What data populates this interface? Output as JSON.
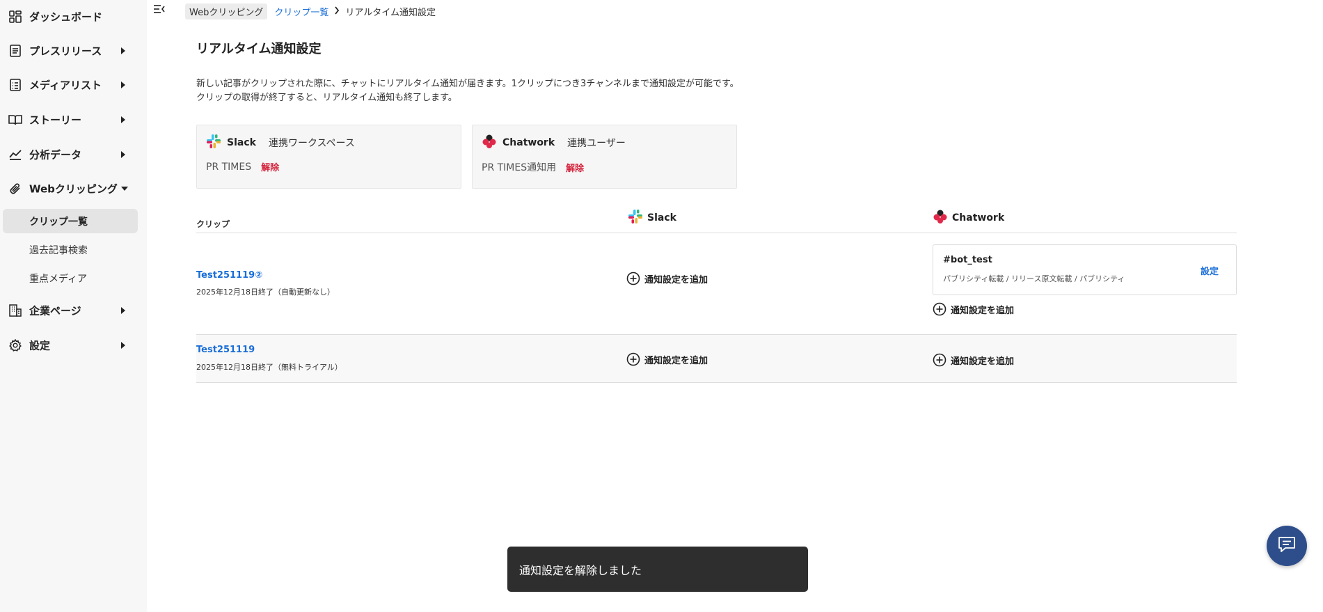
{
  "sidebar": {
    "items": [
      {
        "label": "ダッシュボード",
        "icon": "dashboard-icon"
      },
      {
        "label": "プレスリリース",
        "icon": "document-icon"
      },
      {
        "label": "メディアリスト",
        "icon": "list-icon"
      },
      {
        "label": "ストーリー",
        "icon": "book-icon"
      },
      {
        "label": "分析データ",
        "icon": "chart-line-icon"
      },
      {
        "label": "Webクリッピング",
        "icon": "paperclip-icon"
      },
      {
        "label": "企業ページ",
        "icon": "building-icon"
      },
      {
        "label": "設定",
        "icon": "gear-icon"
      }
    ],
    "subitems": [
      {
        "label": "クリップ一覧",
        "active": true
      },
      {
        "label": "過去記事検索",
        "active": false
      },
      {
        "label": "重点メディア",
        "active": false
      }
    ]
  },
  "breadcrumb": {
    "root": "Webクリッピング",
    "parent": "クリップ一覧",
    "current": "リアルタイム通知設定"
  },
  "page": {
    "title": "リアルタイム通知設定",
    "desc_line1": "新しい記事がクリップされた際に、チャットにリアルタイム通知が届きます。1クリップにつき3チャンネルまで通知設定が可能です。",
    "desc_line2": "クリップの取得が終了すると、リアルタイム通知も終了します。"
  },
  "integrations": {
    "slack": {
      "service": "Slack",
      "kind": "連携ワークスペース",
      "account": "PR TIMES",
      "unlink": "解除"
    },
    "chatwork": {
      "service": "Chatwork",
      "kind": "連携ユーザー",
      "account": "PR TIMES通知用",
      "unlink": "解除"
    }
  },
  "table": {
    "headers": {
      "clip": "クリップ",
      "slack": "Slack",
      "chatwork": "Chatwork"
    },
    "add_label": "通知設定を追加",
    "rows": [
      {
        "name": "Test251119②",
        "sub": "2025年12月18日終了（自動更新なし）",
        "chatwork_setting": {
          "channel": "#bot_test",
          "types": "パブリシティ転載 / リリース原文転載 / パブリシティ",
          "action": "設定"
        }
      },
      {
        "name": "Test251119",
        "sub": "2025年12月18日終了（無料トライアル）"
      }
    ]
  },
  "toast": {
    "message": "通知設定を解除しました"
  },
  "colors": {
    "link": "#1a6ed8",
    "danger": "#d4213b",
    "toast_bg": "#2e2e2e",
    "fab": "#2d4e8a"
  }
}
